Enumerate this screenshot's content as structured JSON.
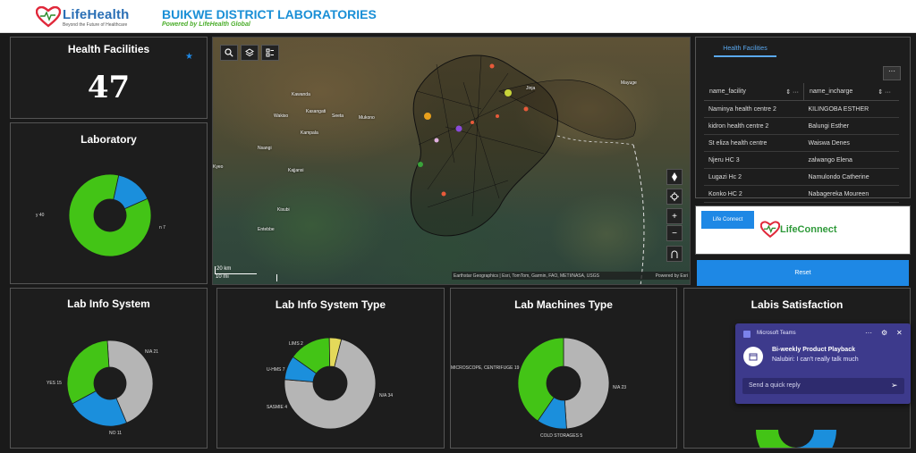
{
  "header": {
    "brand_name": "LifeHealth",
    "brand_tagline": "Beyond the Future of Healthcare",
    "title": "BUIKWE DISTRICT LABORATORIES",
    "subtitle": "Powered by LifeHealth Global"
  },
  "health_facilities": {
    "title": "Health Facilities",
    "value": "47"
  },
  "laboratory": {
    "title": "Laboratory"
  },
  "map": {
    "places": [
      "Kawanda",
      "Wakiso",
      "Kasangati",
      "Seeta",
      "Mukono",
      "Kampala",
      "Nsangi",
      "Kajjansi",
      "Kyeo",
      "Kisubi",
      "Entebbe",
      "Jinja",
      "Mayuge"
    ],
    "scale_km": "20 km",
    "scale_mi": "10 mi",
    "attribution": "Earthstar Geographics | Esri, TomTom, Garmin, FAO, METI/NASA, USGS",
    "powered": "Powered by Esri"
  },
  "facilities_table": {
    "tab": "Health Facilities",
    "col1": "name_facility",
    "col2": "name_incharge",
    "rows": [
      [
        "Naminya health centre 2",
        "KILINGOBA ESTHER"
      ],
      [
        "kidron health centre 2",
        "Balungi Esther"
      ],
      [
        "St eliza health centre",
        "Waiswa Denes"
      ],
      [
        "Njeru HC 3",
        "zalwango Elena"
      ],
      [
        "Lugazi Hc 2",
        "Namulondo Catherine"
      ],
      [
        "Konko HC 2",
        "Nabagereka Moureen"
      ]
    ]
  },
  "life_connect": {
    "button": "Life Connect",
    "logo": "LifeConnect"
  },
  "reset": {
    "label": "Reset"
  },
  "colors": {
    "green": "#43c416",
    "blue": "#1b8fdc",
    "grey": "#b5b5b5",
    "yellow": "#e3d95a",
    "reset_blue": "#1e88e5"
  },
  "chart_data": [
    {
      "type": "pie",
      "title": "Laboratory",
      "labels": [
        "y 40",
        "n 7"
      ],
      "values": [
        40,
        7
      ],
      "colors": [
        "#43c416",
        "#1b8fdc"
      ]
    },
    {
      "type": "pie",
      "title": "Lab Info System",
      "labels": [
        "N/A 21",
        "NO 11",
        "YES 15"
      ],
      "values": [
        21,
        11,
        15
      ],
      "colors": [
        "#b5b5b5",
        "#1b8fdc",
        "#43c416"
      ]
    },
    {
      "type": "pie",
      "title": "Lab Info System Type",
      "labels": [
        "N/A 34",
        "SASMIE 4",
        "U-HMS 7",
        "LIMS 2"
      ],
      "values": [
        34,
        4,
        7,
        2
      ],
      "colors": [
        "#b5b5b5",
        "#1b8fdc",
        "#43c416",
        "#e3d95a"
      ]
    },
    {
      "type": "pie",
      "title": "Lab Machines Type",
      "labels": [
        "N/A 23",
        "COLD STORAGES 5",
        "MICROSCOPE, CENTRIFUGE 19"
      ],
      "values": [
        23,
        5,
        19
      ],
      "colors": [
        "#b5b5b5",
        "#1b8fdc",
        "#43c416"
      ]
    },
    {
      "type": "pie",
      "title": "Labis Satisfaction",
      "labels": [],
      "values": [],
      "colors": [
        "#43c416",
        "#1b8fdc"
      ]
    }
  ],
  "teams": {
    "app": "Microsoft Teams",
    "meeting": "Bi-weekly Product Playback",
    "message": "Nalubiri: I can't really talk much",
    "reply_placeholder": "Send a quick reply"
  }
}
